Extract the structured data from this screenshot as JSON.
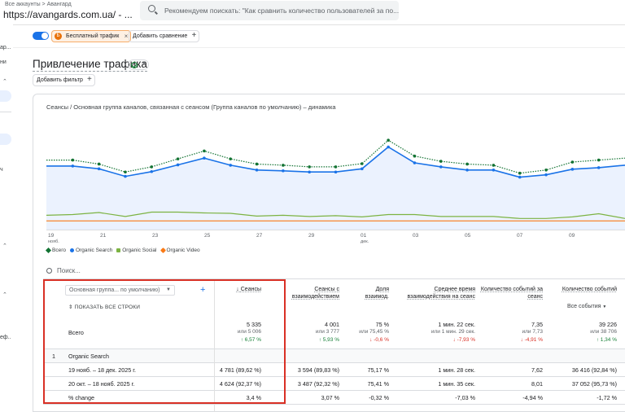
{
  "header": {
    "breadcrumb": "Все аккаунты > Авангард",
    "property": "https://avangards.com.ua/ - ...",
    "search_placeholder": "Рекомендуем поискать: \"Как сравнить количество пользователей за по..."
  },
  "rail_fragments": [
    "ар...",
    "ни",
    "еф..",
    "ч"
  ],
  "comparisons": {
    "segment_badge": "Б",
    "segment": "Бесплатный трафик",
    "add_comparison": "Добавить сравнение",
    "add_filter": "Добавить фильтр"
  },
  "page_title": "Привлечение трафика",
  "chart_data": {
    "type": "line",
    "title": "Сеансы / Основная группа каналов, связанная с сеансом (Группа каналов по умолчанию) – динамика",
    "x_ticks": [
      {
        "label": "19",
        "sub": "нояб."
      },
      {
        "label": "21",
        "sub": ""
      },
      {
        "label": "23",
        "sub": ""
      },
      {
        "label": "25",
        "sub": ""
      },
      {
        "label": "27",
        "sub": ""
      },
      {
        "label": "29",
        "sub": ""
      },
      {
        "label": "01",
        "sub": "дек."
      },
      {
        "label": "03",
        "sub": ""
      },
      {
        "label": "05",
        "sub": ""
      },
      {
        "label": "07",
        "sub": ""
      },
      {
        "label": "09",
        "sub": ""
      }
    ],
    "series": [
      {
        "name": "Всего",
        "color": "#137333",
        "values": [
          175,
          175,
          165,
          145,
          158,
          178,
          198,
          178,
          165,
          162,
          158,
          158,
          166,
          225,
          185,
          172,
          165,
          162,
          142,
          150,
          170,
          175,
          180
        ]
      },
      {
        "name": "Organic Search",
        "color": "#1a73e8",
        "values": [
          160,
          160,
          153,
          134,
          146,
          163,
          180,
          162,
          150,
          148,
          145,
          145,
          153,
          208,
          168,
          158,
          150,
          150,
          132,
          138,
          152,
          156,
          162
        ]
      },
      {
        "name": "Organic Social",
        "color": "#7cb342",
        "values": [
          36,
          38,
          43,
          33,
          44,
          44,
          42,
          41,
          34,
          36,
          33,
          35,
          32,
          38,
          38,
          33,
          33,
          33,
          28,
          28,
          32,
          40,
          28
        ]
      },
      {
        "name": "Organic Video",
        "color": "#fa7b17",
        "values": [
          22,
          22,
          22,
          22,
          22,
          22,
          22,
          22,
          22,
          22,
          22,
          22,
          22,
          22,
          22,
          22,
          22,
          22,
          22,
          22,
          22,
          22,
          22
        ]
      }
    ],
    "grid": false,
    "legend": "bottom-left"
  },
  "table": {
    "search_placeholder": "Поиск...",
    "dimension": "Основная группа... по умолчанию)",
    "show_all": "ПОКАЗАТЬ ВСЕ СТРОКИ",
    "event_select": "Все события",
    "columns": [
      "Сеансы",
      "Сеансы с взаимодействием",
      "Доля взаимод.",
      "Среднее время взаимодействия на сеанс",
      "Количество событий за сеанс",
      "Количество событий"
    ],
    "total": {
      "label": "Всего",
      "values": [
        "5 335",
        "4 001",
        "75 %",
        "1 мин. 22 сек.",
        "7,35",
        "39 226"
      ],
      "compare": [
        "или 5 006",
        "или 3 777",
        "или 75,45 %",
        "или 1 мин. 29 сек.",
        "или 7,73",
        "или 38 706"
      ],
      "change": [
        "↑ 6,57 %",
        "↑ 5,93 %",
        "↓ -0,6 %",
        "↓ -7,93 %",
        "↓ -4,91 %",
        "↑ 1,34 %"
      ],
      "change_dir": [
        "up",
        "up",
        "down",
        "down",
        "down",
        "up"
      ]
    },
    "group": {
      "index": "1",
      "label": "Organic Search"
    },
    "rows": [
      {
        "label": "19 нояб. – 18 дек. 2025 г.",
        "values": [
          "4 781 (89,62 %)",
          "3 594 (89,83 %)",
          "75,17 %",
          "1 мин. 28 сек.",
          "7,62",
          "36 416 (92,84 %)"
        ]
      },
      {
        "label": "20 окт. – 18 нояб. 2025 г.",
        "values": [
          "4 624 (92,37 %)",
          "3 487 (92,32 %)",
          "75,41 %",
          "1 мин. 35 сек.",
          "8,01",
          "37 052 (95,73 %)"
        ]
      },
      {
        "label": "% change",
        "values": [
          "3,4 %",
          "3,07 %",
          "-0,32 %",
          "-7,03 %",
          "-4,94 %",
          "-1,72 %"
        ]
      }
    ]
  }
}
